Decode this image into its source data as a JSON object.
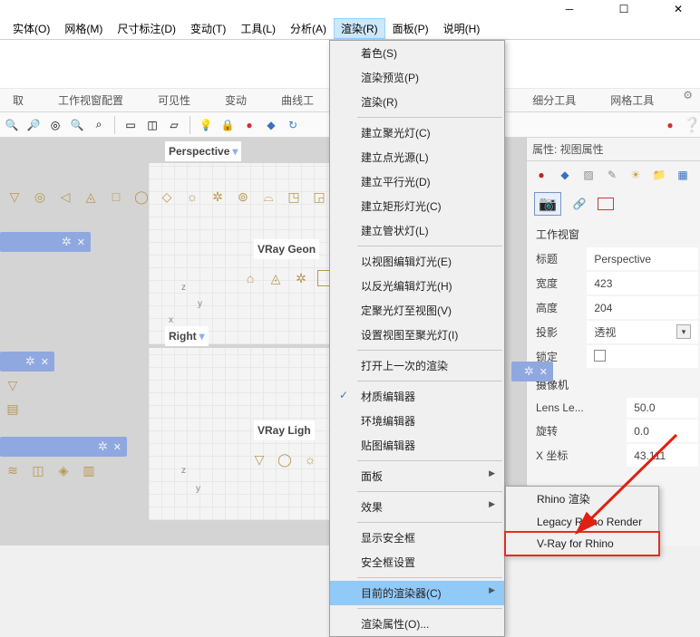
{
  "window_controls": {
    "min": "─",
    "max": "☐",
    "close": "✕"
  },
  "menubar": [
    "实体(O)",
    "网格(M)",
    "尺寸标注(D)",
    "变动(T)",
    "工具(L)",
    "分析(A)",
    "渲染(R)",
    "面板(P)",
    "说明(H)"
  ],
  "active_menu": "渲染(R)",
  "tabs_left": [
    "取",
    "工作视窗配置",
    "可见性",
    "变动",
    "曲线工"
  ],
  "tabs_right": [
    "细分工具",
    "网格工具"
  ],
  "gear_icon": "⚙",
  "viewport": {
    "perspective_label": "Perspective",
    "right_label": "Right",
    "vray_geom": "VRay Geon",
    "vray_light": "VRay Ligh",
    "axis": {
      "x": "x",
      "y": "y",
      "z": "z"
    }
  },
  "icon_row_top": [
    "▽",
    "◎",
    "▷",
    "◬",
    "□",
    "◯",
    "◇",
    "☼",
    "✲",
    "◈",
    "◉",
    "▣",
    "◪",
    "⬚",
    "⬛",
    "⬜",
    "▧"
  ],
  "bottom_icons": [
    "≋",
    "◫",
    "◈",
    "▥"
  ],
  "properties": {
    "header": "属性: 视图属性",
    "section1": "工作视窗",
    "rows1": [
      {
        "k": "标题",
        "v": "Perspective"
      },
      {
        "k": "宽度",
        "v": "423"
      },
      {
        "k": "高度",
        "v": "204"
      },
      {
        "k": "投影",
        "v": "透视",
        "dd": true
      },
      {
        "k": "锁定",
        "chk": true
      }
    ],
    "section2": "摄像机",
    "rows2": [
      {
        "k": "Lens Le...",
        "v": "50.0"
      },
      {
        "k": "旋转",
        "v": "0.0"
      },
      {
        "k": "X 坐标",
        "v": "43.111"
      }
    ]
  },
  "render_menu": {
    "items": [
      {
        "t": "着色(S)"
      },
      {
        "t": "渲染预览(P)"
      },
      {
        "t": "渲染(R)"
      },
      {
        "sep": true
      },
      {
        "t": "建立聚光灯(C)"
      },
      {
        "t": "建立点光源(L)"
      },
      {
        "t": "建立平行光(D)"
      },
      {
        "t": "建立矩形灯光(C)"
      },
      {
        "t": "建立管状灯(L)"
      },
      {
        "sep": true
      },
      {
        "t": "以视图编辑灯光(E)"
      },
      {
        "t": "以反光编辑灯光(H)"
      },
      {
        "t": "定聚光灯至视图(V)"
      },
      {
        "t": "设置视图至聚光灯(I)"
      },
      {
        "sep": true
      },
      {
        "t": "打开上一次的渲染"
      },
      {
        "sep": true
      },
      {
        "t": "材质编辑器",
        "chk": true
      },
      {
        "t": "环境编辑器"
      },
      {
        "t": "贴图编辑器"
      },
      {
        "sep": true
      },
      {
        "t": "面板",
        "sub": true
      },
      {
        "sep": true
      },
      {
        "t": "效果",
        "sub": true
      },
      {
        "sep": true
      },
      {
        "t": "显示安全框"
      },
      {
        "t": "安全框设置"
      },
      {
        "sep": true
      },
      {
        "t": "目前的渲染器(C)",
        "sub": true,
        "hl": true
      },
      {
        "sep": true
      },
      {
        "t": "渲染属性(O)..."
      }
    ]
  },
  "renderer_submenu": [
    "Rhino 渲染",
    "Legacy Rhino Render",
    "V-Ray for Rhino"
  ]
}
